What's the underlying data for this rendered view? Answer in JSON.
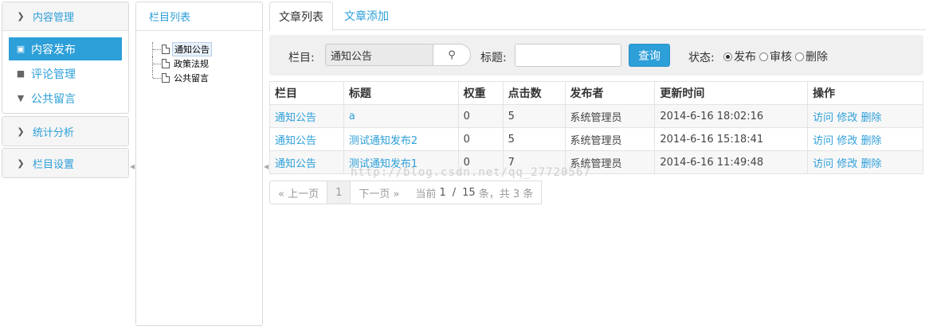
{
  "sidebar": {
    "group1": {
      "title": "内容管理"
    },
    "items": [
      {
        "label": "内容发布",
        "icon": "briefcase-icon"
      },
      {
        "label": "评论管理",
        "icon": "comment-icon"
      },
      {
        "label": "公共留言",
        "icon": "filter-icon"
      }
    ],
    "group2": {
      "title": "统计分析"
    },
    "group3": {
      "title": "栏目设置"
    }
  },
  "tree": {
    "title": "栏目列表",
    "nodes": [
      "通知公告",
      "政策法规",
      "公共留言"
    ]
  },
  "tabs": [
    "文章列表",
    "文章添加"
  ],
  "filter": {
    "column_label": "栏目:",
    "column_value": "通知公告",
    "title_label": "标题:",
    "title_value": "",
    "query_button": "查询",
    "status_label": "状态:",
    "status_options": [
      "发布",
      "审核",
      "删除"
    ],
    "status_selected": "发布"
  },
  "table": {
    "headers": [
      "栏目",
      "标题",
      "权重",
      "点击数",
      "发布者",
      "更新时间",
      "操作"
    ],
    "rows": [
      {
        "column": "通知公告",
        "title": "a",
        "weight": "0",
        "clicks": "5",
        "publisher": "系统管理员",
        "updated": "2014-6-16 18:02:16"
      },
      {
        "column": "通知公告",
        "title": "测试通知发布2",
        "weight": "0",
        "clicks": "5",
        "publisher": "系统管理员",
        "updated": "2014-6-16 15:18:41"
      },
      {
        "column": "通知公告",
        "title": "测试通知发布1",
        "weight": "0",
        "clicks": "7",
        "publisher": "系统管理员",
        "updated": "2014-6-16 11:49:48"
      }
    ],
    "actions": [
      "访问",
      "修改",
      "删除"
    ]
  },
  "watermark": "http://blog.csdn.net/qq_27720567",
  "pager": {
    "prev": "« 上一页",
    "current": "1",
    "next": "下一页 »",
    "info_prefix": "当前",
    "page": "1",
    "sep": "/",
    "total_pages": "15",
    "info_suffix": "条，共 3 条"
  }
}
